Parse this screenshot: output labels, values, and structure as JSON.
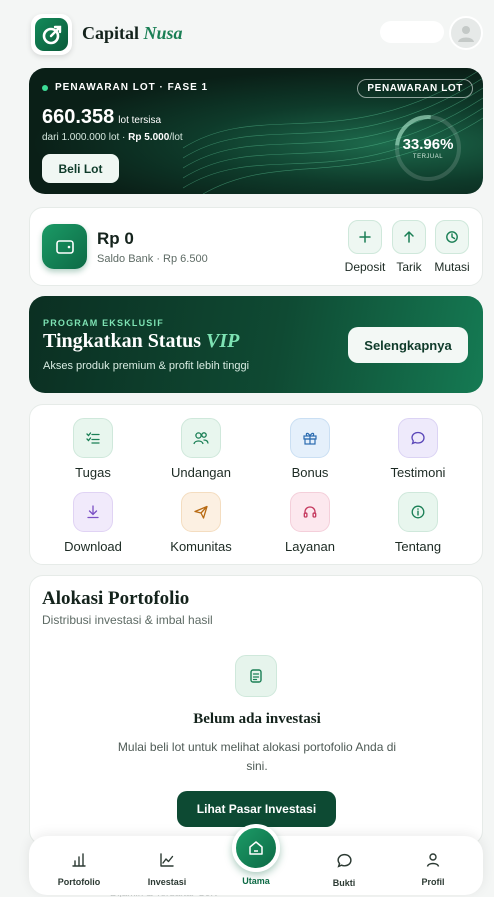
{
  "header": {
    "brand_main": "Capital",
    "brand_accent": "Nusa"
  },
  "offer": {
    "kicker": "PENAWARAN LOT · FASE 1",
    "tag": "PENAWARAN LOT",
    "remaining": "660.358",
    "remaining_unit": "lot tersisa",
    "from_text": "dari 1.000.000 lot · ",
    "price": "Rp 5.000",
    "price_unit": "/lot",
    "buy_label": "Beli Lot",
    "sold_pct": "33.96%",
    "sold_pct_value": 33.96,
    "sold_label": "TERJUAL"
  },
  "balance": {
    "amount": "Rp 0",
    "bank": "Saldo Bank · Rp 6.500",
    "actions": [
      {
        "label": "Deposit",
        "icon": "plus-icon"
      },
      {
        "label": "Tarik",
        "icon": "arrow-up-icon"
      },
      {
        "label": "Mutasi",
        "icon": "history-icon"
      }
    ]
  },
  "vip": {
    "kicker": "PROGRAM EKSKLUSIF",
    "title": "Tingkatkan Status",
    "title_accent": "VIP",
    "subtitle": "Akses produk premium & profit lebih tinggi",
    "button": "Selengkapnya"
  },
  "menu": [
    {
      "label": "Tugas",
      "icon": "checklist-icon",
      "color": "#e8f6ee"
    },
    {
      "label": "Undangan",
      "icon": "users-icon",
      "color": "#e8f6ee"
    },
    {
      "label": "Bonus",
      "icon": "gift-icon",
      "color": "#e5f0fb"
    },
    {
      "label": "Testimoni",
      "icon": "chat-icon",
      "color": "#eeeafb"
    },
    {
      "label": "Download",
      "icon": "download-icon",
      "color": "#f1eafb"
    },
    {
      "label": "Komunitas",
      "icon": "send-icon",
      "color": "#fcf0e2"
    },
    {
      "label": "Layanan",
      "icon": "headset-icon",
      "color": "#fce8ee"
    },
    {
      "label": "Tentang",
      "icon": "info-icon",
      "color": "#e8f6ee"
    }
  ],
  "portfolio": {
    "title": "Alokasi Portofolio",
    "subtitle": "Distribusi investasi & imbal hasil",
    "empty_title": "Belum ada investasi",
    "empty_desc": "Mulai beli lot untuk melihat alokasi portofolio Anda di sini.",
    "button": "Lihat Pasar Investasi"
  },
  "nav": [
    {
      "label": "Portofolio",
      "icon": "bar-chart-icon"
    },
    {
      "label": "Investasi",
      "icon": "trend-icon"
    },
    {
      "label": "Utama",
      "icon": "home-icon"
    },
    {
      "label": "Bukti",
      "icon": "chat-icon"
    },
    {
      "label": "Profil",
      "icon": "user-icon"
    }
  ],
  "ghost_text": "Dijamin & Terdaftar OJK"
}
